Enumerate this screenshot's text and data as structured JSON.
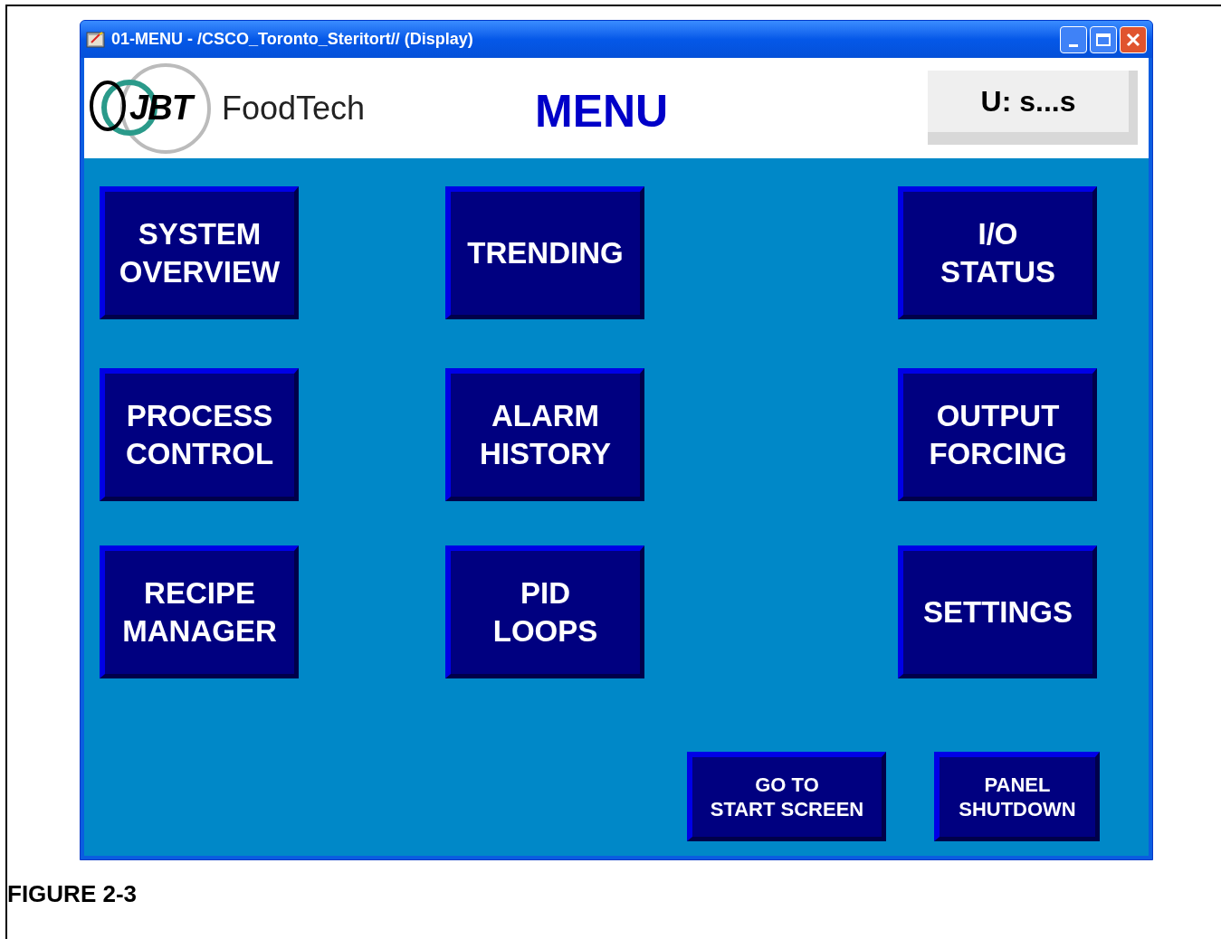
{
  "window": {
    "title": "01-MENU - /CSCO_Toronto_Steritort// (Display)"
  },
  "header": {
    "logo": {
      "mark": "JBT",
      "wordmark": "FoodTech"
    },
    "title": "MENU",
    "user": "U: s...s"
  },
  "menu_rows": [
    {
      "buttons": [
        {
          "lines": [
            "SYSTEM",
            "OVERVIEW"
          ]
        },
        {
          "lines": [
            "TRENDING"
          ]
        },
        {
          "lines": [
            "I/O",
            "STATUS"
          ]
        }
      ]
    },
    {
      "buttons": [
        {
          "lines": [
            "PROCESS",
            "CONTROL"
          ]
        },
        {
          "lines": [
            "ALARM",
            "HISTORY"
          ]
        },
        {
          "lines": [
            "OUTPUT",
            "FORCING"
          ]
        }
      ]
    },
    {
      "buttons": [
        {
          "lines": [
            "RECIPE",
            "MANAGER"
          ]
        },
        {
          "lines": [
            "PID",
            "LOOPS"
          ]
        },
        {
          "lines": [
            "SETTINGS"
          ]
        }
      ]
    }
  ],
  "bottom_buttons": [
    {
      "lines": [
        "GO TO",
        "START SCREEN"
      ]
    },
    {
      "lines": [
        "PANEL",
        "SHUTDOWN"
      ]
    }
  ],
  "caption": "FIGURE 2-3"
}
